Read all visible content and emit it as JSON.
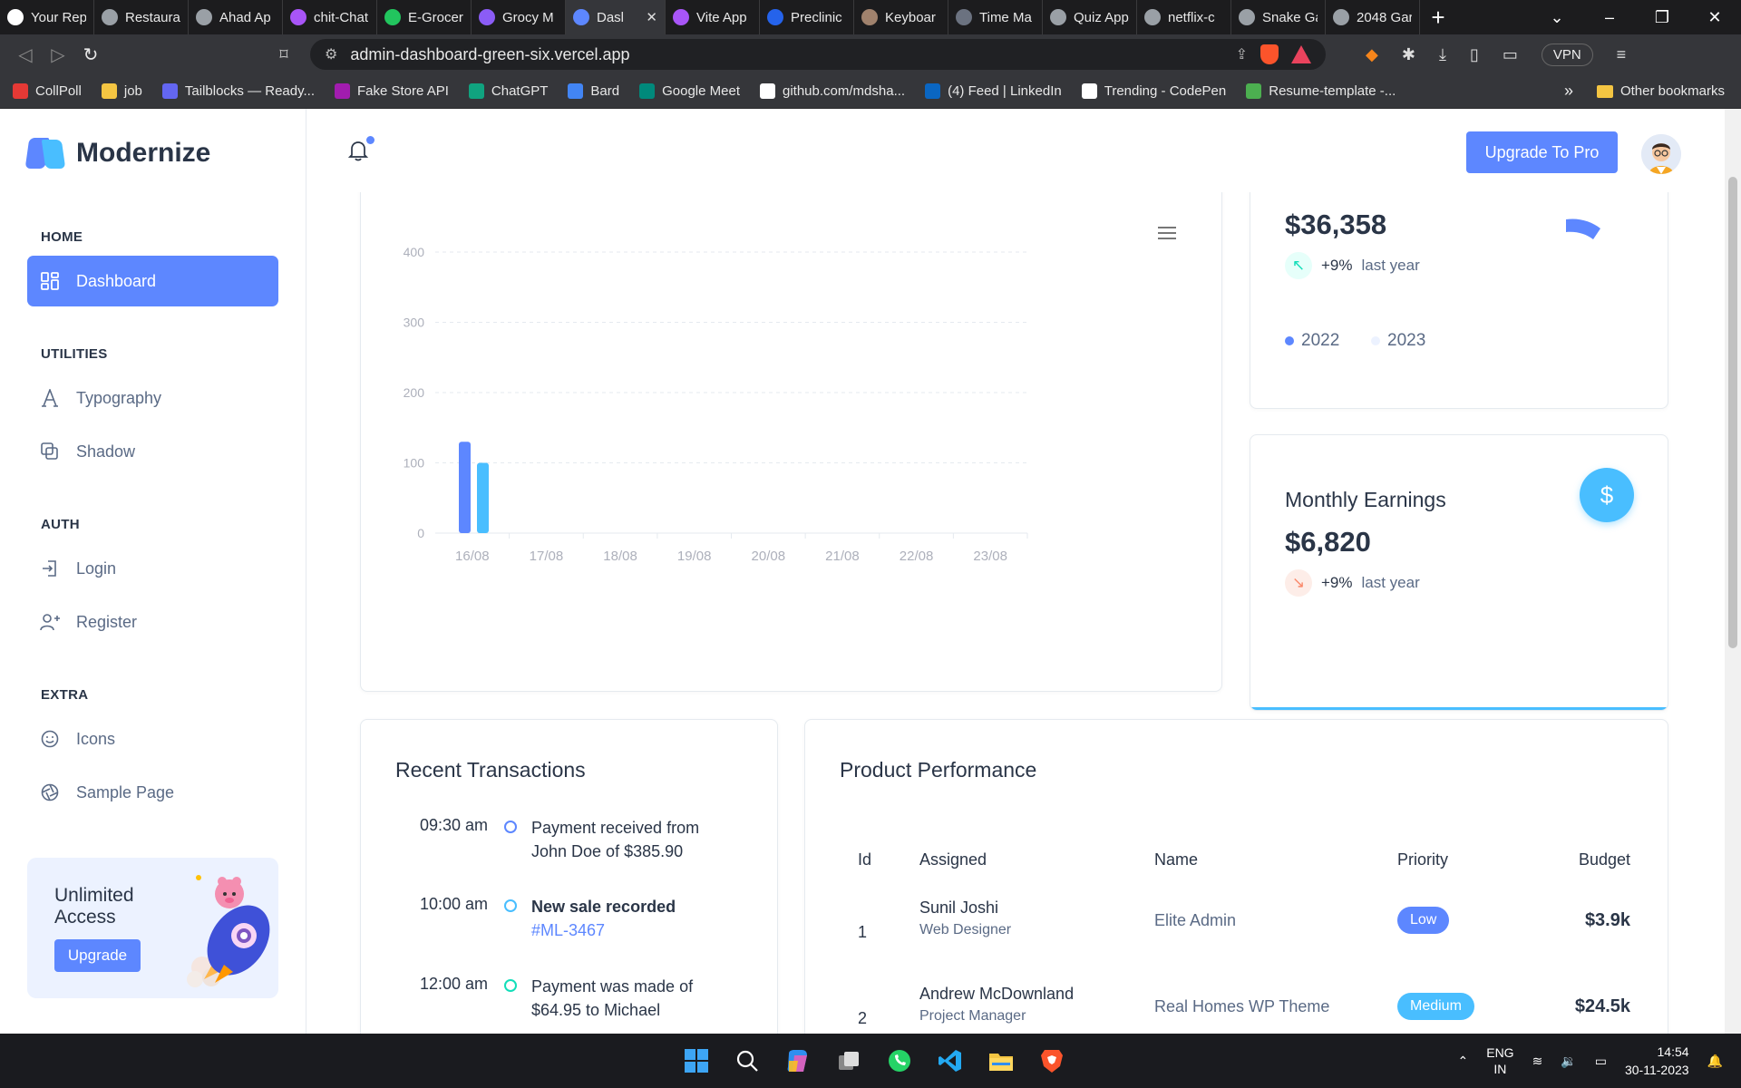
{
  "browser": {
    "tabs": [
      {
        "label": "Your Rep",
        "icon": "github-icon",
        "color": "#ffffff"
      },
      {
        "label": "Restaurar",
        "icon": "globe-icon",
        "color": "#9aa0a6"
      },
      {
        "label": "Ahad Ap",
        "icon": "globe-icon",
        "color": "#9aa0a6"
      },
      {
        "label": "chit-Chat",
        "icon": "vite-icon",
        "color": "#a855f7"
      },
      {
        "label": "E-Grocer",
        "icon": "leaf-icon",
        "color": "#22c55e"
      },
      {
        "label": "Grocy M",
        "icon": "grocy-icon",
        "color": "#8b5cf6"
      },
      {
        "label": "Dasl",
        "icon": "modernize-icon",
        "color": "#5d87ff",
        "active": true
      },
      {
        "label": "Vite App",
        "icon": "vite-icon",
        "color": "#a855f7"
      },
      {
        "label": "Preclinic",
        "icon": "plus-circle-icon",
        "color": "#2563eb"
      },
      {
        "label": "Keyboar",
        "icon": "keyboard-icon",
        "color": "#a0826d"
      },
      {
        "label": "Time Ma",
        "icon": "timer-icon",
        "color": "#6b7280"
      },
      {
        "label": "Quiz App",
        "icon": "globe-icon",
        "color": "#9aa0a6"
      },
      {
        "label": "netflix-c",
        "icon": "globe-icon",
        "color": "#9aa0a6"
      },
      {
        "label": "Snake Ga",
        "icon": "globe-icon",
        "color": "#9aa0a6"
      },
      {
        "label": "2048 Gar",
        "icon": "globe-icon",
        "color": "#9aa0a6"
      }
    ],
    "url": "admin-dashboard-green-six.vercel.app",
    "vpn_label": "VPN",
    "bookmarks": [
      {
        "label": "CollPoll",
        "color": "#e53935"
      },
      {
        "label": "job",
        "color": "#f4c542"
      },
      {
        "label": "Tailblocks — Ready...",
        "color": "#6366f1"
      },
      {
        "label": "Fake Store API",
        "color": "#a21caf"
      },
      {
        "label": "ChatGPT",
        "color": "#10a37f"
      },
      {
        "label": "Bard",
        "color": "#4285f4"
      },
      {
        "label": "Google Meet",
        "color": "#00897b"
      },
      {
        "label": "github.com/mdsha...",
        "color": "#ffffff"
      },
      {
        "label": "(4) Feed | LinkedIn",
        "color": "#0a66c2"
      },
      {
        "label": "Trending - CodePen",
        "color": "#ffffff"
      },
      {
        "label": "Resume-template -...",
        "color": "#4caf50"
      }
    ],
    "bookmarks_more": "»",
    "other_bookmarks": "Other bookmarks"
  },
  "sidebar": {
    "brand": "Modernize",
    "sections": [
      {
        "title": "HOME",
        "items": [
          {
            "label": "Dashboard",
            "icon": "dashboard-icon",
            "active": true
          }
        ]
      },
      {
        "title": "UTILITIES",
        "items": [
          {
            "label": "Typography",
            "icon": "typography-icon"
          },
          {
            "label": "Shadow",
            "icon": "shadow-icon"
          }
        ]
      },
      {
        "title": "AUTH",
        "items": [
          {
            "label": "Login",
            "icon": "login-icon"
          },
          {
            "label": "Register",
            "icon": "user-plus-icon"
          }
        ]
      },
      {
        "title": "EXTRA",
        "items": [
          {
            "label": "Icons",
            "icon": "mood-icon"
          },
          {
            "label": "Sample Page",
            "icon": "aperture-icon"
          }
        ]
      }
    ],
    "promo": {
      "title": "Unlimited Access",
      "button": "Upgrade"
    }
  },
  "header": {
    "upgrade_button": "Upgrade To Pro"
  },
  "chart_data": {
    "type": "bar",
    "categories": [
      "16/08",
      "17/08",
      "18/08",
      "19/08",
      "20/08",
      "21/08",
      "22/08",
      "23/08"
    ],
    "series": [
      {
        "values": [
          130,
          null,
          null,
          null,
          null,
          null,
          null,
          null
        ],
        "color": "#5d87ff"
      },
      {
        "values": [
          100,
          null,
          null,
          null,
          null,
          null,
          null,
          null
        ],
        "color": "#49beff"
      }
    ],
    "yticks": [
      "400",
      "300",
      "200",
      "100",
      "0"
    ],
    "ylim": [
      0,
      400
    ],
    "grid": true
  },
  "yearly": {
    "amount": "$36,358",
    "trend_pct": "+9%",
    "trend_label": "last year",
    "legend": [
      {
        "label": "2022",
        "color": "#5d87ff"
      },
      {
        "label": "2023",
        "color": "#ecf2ff"
      }
    ]
  },
  "earnings": {
    "title": "Monthly Earnings",
    "amount": "$6,820",
    "trend_pct": "+9%",
    "trend_label": "last year"
  },
  "transactions": {
    "title": "Recent Transactions",
    "items": [
      {
        "time": "09:30 am",
        "text": "Payment received from John Doe of $385.90",
        "color": "#5d87ff"
      },
      {
        "time": "10:00 am",
        "text": "New sale recorded",
        "link": "#ML-3467",
        "color": "#49beff"
      },
      {
        "time": "12:00 am",
        "text": "Payment was made of $64.95 to Michael",
        "color": "#13deb9"
      }
    ]
  },
  "performance": {
    "title": "Product Performance",
    "columns": [
      "Id",
      "Assigned",
      "Name",
      "Priority",
      "Budget"
    ],
    "rows": [
      {
        "id": "1",
        "assigned": "Sunil Joshi",
        "role": "Web Designer",
        "name": "Elite Admin",
        "priority": "Low",
        "priority_color": "#5d87ff",
        "budget": "$3.9k"
      },
      {
        "id": "2",
        "assigned": "Andrew McDownland",
        "role": "Project Manager",
        "name": "Real Homes WP Theme",
        "priority": "Medium",
        "priority_color": "#49beff",
        "budget": "$24.5k"
      }
    ]
  },
  "taskbar": {
    "lang_top": "ENG",
    "lang_bottom": "IN",
    "time": "14:54",
    "date": "30-11-2023"
  }
}
